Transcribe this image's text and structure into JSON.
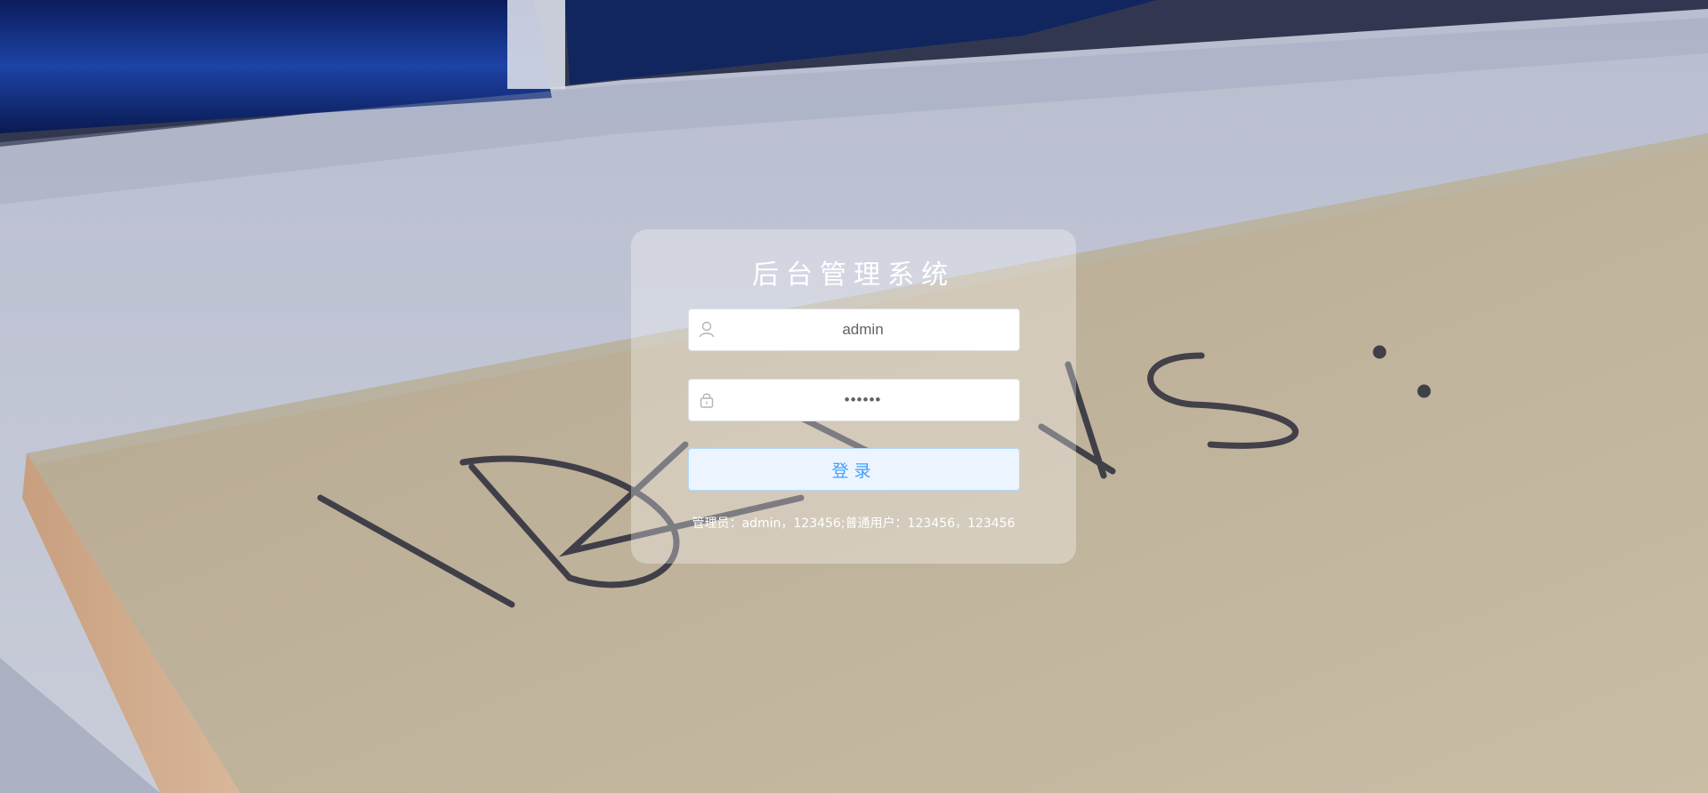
{
  "app": {
    "title": "后台管理系统"
  },
  "login": {
    "username_value": "admin",
    "password_value": "123456",
    "submit_label": "登录",
    "hint": "管理员：admin，123456;普通用户：123456，123456"
  },
  "icons": {
    "username": "user-icon",
    "password": "lock-icon"
  },
  "colors": {
    "primary": "#409eff",
    "button_bg": "#ecf5ff",
    "button_border": "#b3d8ff",
    "card_bg": "rgba(255,255,255,0.32)"
  }
}
